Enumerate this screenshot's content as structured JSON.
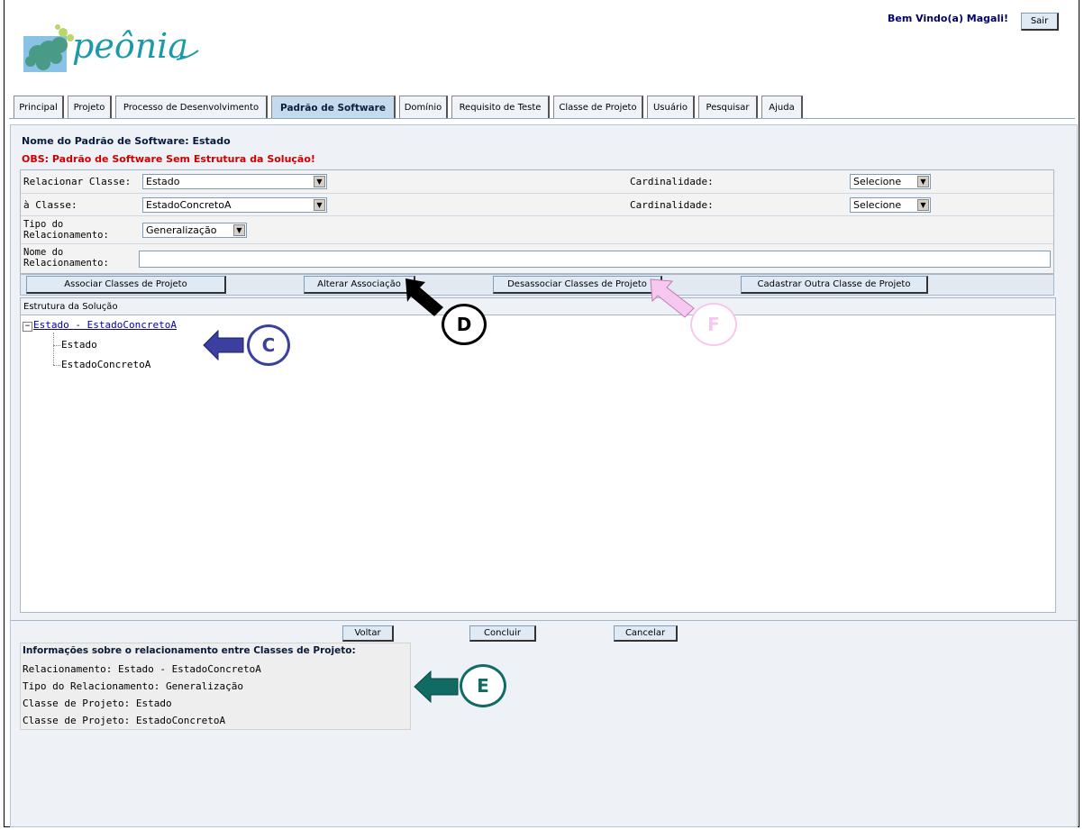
{
  "header": {
    "logo_text": "peônia",
    "welcome": "Bem Vindo(a) Magali!",
    "logout": "Sair"
  },
  "tabs": [
    {
      "label": "Principal"
    },
    {
      "label": "Projeto"
    },
    {
      "label": "Processo de Desenvolvimento"
    },
    {
      "label": "Padrão de Software",
      "active": true
    },
    {
      "label": "Domínio"
    },
    {
      "label": "Requisito de Teste"
    },
    {
      "label": "Classe de Projeto"
    },
    {
      "label": "Usuário"
    },
    {
      "label": "Pesquisar"
    },
    {
      "label": "Ajuda"
    }
  ],
  "page": {
    "pattern_name": "Nome do Padrão de Software: Estado",
    "warning": "OBS: Padrão de Software Sem Estrutura da Solução!"
  },
  "form": {
    "relate_label": "Relacionar Classe:",
    "relate_value": "Estado",
    "card1_label": "Cardinalidade:",
    "card1_value": "Selecione",
    "to_label": "à Classe:",
    "to_value": "EstadoConcretoA",
    "card2_label": "Cardinalidade:",
    "card2_value": "Selecione",
    "type_label": "Tipo do Relacionamento:",
    "type_value": "Generalização",
    "name_label": "Nome do Relacionamento:",
    "name_value": ""
  },
  "actions": {
    "associate": "Associar Classes de Projeto",
    "alter": "Alterar Associação",
    "disassociate": "Desassociar Classes de Projeto",
    "register": "Cadastrar Outra Classe de Projeto"
  },
  "tree": {
    "header": "Estrutura da Solução",
    "expander": "−",
    "root": "Estado - EstadoConcretoA",
    "children": [
      "Estado",
      "EstadoConcretoA"
    ]
  },
  "bottom_buttons": {
    "back": "Voltar",
    "finish": "Concluir",
    "cancel": "Cancelar"
  },
  "info": {
    "title": "Informações sobre o relacionamento entre Classes de Projeto:",
    "lines": [
      "Relacionamento: Estado - EstadoConcretoA",
      "Tipo do Relacionamento: Generalização",
      "Classe de Projeto: Estado",
      "Classe de Projeto: EstadoConcretoA"
    ]
  },
  "annotations": {
    "c": "C",
    "d": "D",
    "e": "E",
    "f": "F"
  },
  "colors": {
    "arrow_c": "#3b3fa0",
    "arrow_d": "#000000",
    "arrow_e": "#0f6b64",
    "arrow_f": "#f6c8f0"
  }
}
